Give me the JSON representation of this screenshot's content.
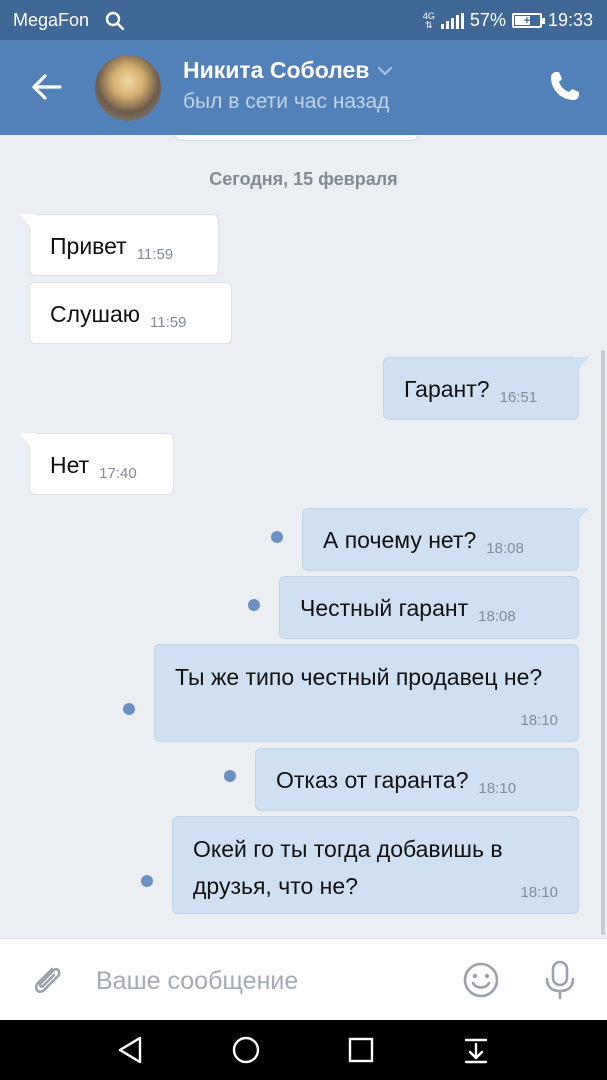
{
  "status_bar": {
    "carrier": "MegaFon",
    "network": "4G",
    "battery": "57%",
    "time": "19:33"
  },
  "header": {
    "contact_name": "Никита Соболев",
    "last_seen": "был в сети час назад"
  },
  "chat": {
    "date_separator": "Сегодня, 15 февраля",
    "messages": [
      {
        "text": "Привет",
        "time": "11:59",
        "direction": "incoming"
      },
      {
        "text": "Слушаю",
        "time": "11:59",
        "direction": "incoming"
      },
      {
        "text": "Гарант?",
        "time": "16:51",
        "direction": "outgoing"
      },
      {
        "text": "Нет",
        "time": "17:40",
        "direction": "incoming"
      },
      {
        "text": "А почему нет?",
        "time": "18:08",
        "direction": "outgoing",
        "unread": true
      },
      {
        "text": "Честный гарант",
        "time": "18:08",
        "direction": "outgoing",
        "unread": true
      },
      {
        "text": "Ты же типо честный продавец не?",
        "time": "18:10",
        "direction": "outgoing",
        "unread": true
      },
      {
        "text": "Отказ от гаранта?",
        "time": "18:10",
        "direction": "outgoing",
        "unread": true
      },
      {
        "text": "Окей го ты тогда добавишь в друзья, что не?",
        "time": "18:10",
        "direction": "outgoing",
        "unread": true
      }
    ]
  },
  "input": {
    "placeholder": "Ваше сообщение"
  },
  "colors": {
    "status_bar": "#3f6896",
    "header": "#5181b8",
    "chat_bg": "#ebeef2",
    "outgoing_bubble": "#cfe0f2",
    "incoming_bubble": "#ffffff",
    "unread_dot": "#6b90c2"
  },
  "icons": {
    "search": "search-icon",
    "signal": "signal-icon",
    "battery": "battery-icon",
    "back": "arrow-left-icon",
    "dropdown": "chevron-down-icon",
    "call": "phone-icon",
    "attach": "paperclip-icon",
    "emoji": "smile-icon",
    "voice": "microphone-icon",
    "nav_back": "triangle-back-icon",
    "nav_home": "circle-home-icon",
    "nav_recents": "square-recents-icon",
    "nav_notifications": "pull-down-icon"
  }
}
